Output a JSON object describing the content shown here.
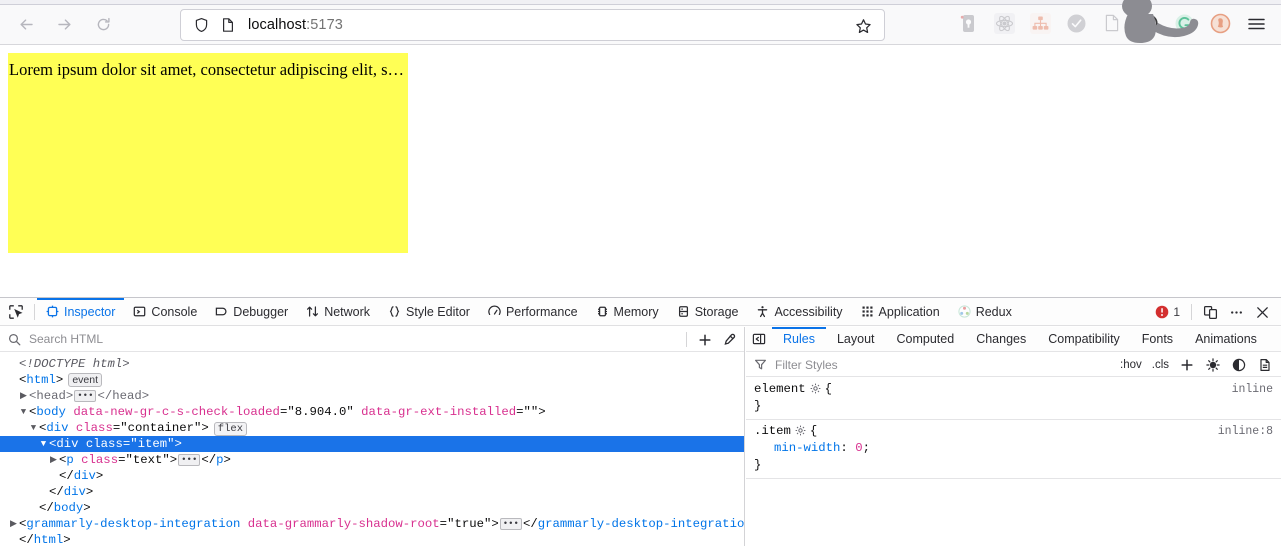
{
  "browser": {
    "nav": {
      "back_label": "Back",
      "forward_label": "Forward",
      "reload_label": "Reload"
    },
    "urlbar": {
      "host": "localhost",
      "port": ":5173",
      "shield_icon": "shield-icon",
      "page_icon": "page-icon",
      "star_icon": "bookmark-star-icon"
    },
    "extensions": [
      {
        "name": "extension-icon-password-manager"
      },
      {
        "name": "extension-icon-react-devtools"
      },
      {
        "name": "extension-icon-sitemap"
      },
      {
        "name": "extension-icon-gray-circle"
      },
      {
        "name": "extension-icon-document"
      },
      {
        "name": "extension-icon-block"
      },
      {
        "name": "extension-icon-grammarly"
      },
      {
        "name": "extension-icon-duckduckgo"
      }
    ],
    "menu_icon": "hamburger-menu-icon",
    "overlay_icon": "cat-silhouette-overlay"
  },
  "page": {
    "item_text": "Lorem ipsum dolor sit amet, consectetur adipiscing elit, sed…",
    "box_color": "#ffff55"
  },
  "devtools": {
    "picker_icon": "element-picker-icon",
    "tabs": [
      {
        "label": "Inspector",
        "icon": "inspector-icon",
        "active": true
      },
      {
        "label": "Console",
        "icon": "console-icon",
        "active": false
      },
      {
        "label": "Debugger",
        "icon": "debugger-icon",
        "active": false
      },
      {
        "label": "Network",
        "icon": "network-icon",
        "active": false
      },
      {
        "label": "Style Editor",
        "icon": "style-editor-icon",
        "active": false
      },
      {
        "label": "Performance",
        "icon": "performance-icon",
        "active": false
      },
      {
        "label": "Memory",
        "icon": "memory-icon",
        "active": false
      },
      {
        "label": "Storage",
        "icon": "storage-icon",
        "active": false
      },
      {
        "label": "Accessibility",
        "icon": "accessibility-icon",
        "active": false
      },
      {
        "label": "Application",
        "icon": "application-icon",
        "active": false
      },
      {
        "label": "Redux",
        "icon": "redux-icon",
        "active": false
      }
    ],
    "error_count": "1",
    "error_icon": "error-badge-icon",
    "responsive_icon": "responsive-design-mode-icon",
    "meatball_icon": "more-options-icon",
    "close_icon": "close-devtools-icon",
    "accent_color": "#0a73e8",
    "error_color": "#d32f2f"
  },
  "dom": {
    "search": {
      "placeholder": "Search HTML",
      "value": "",
      "icon": "search-icon"
    },
    "create_node_icon": "add-node-icon",
    "eyedropper_icon": "eyedropper-icon",
    "rows": [
      {
        "indent": 0,
        "twisty": "",
        "html": "<span class=\"tok-doctype\">&lt;!DOCTYPE html&gt;</span>",
        "selected": false,
        "name": "dom-row-doctype"
      },
      {
        "indent": 0,
        "twisty": "",
        "html": "<span class=\"tok-punct\">&lt;</span><span class=\"tok-tag\">html</span><span class=\"tok-punct\">&gt;</span><span class=\"badge-event\">event</span>",
        "selected": false,
        "name": "dom-row-html"
      },
      {
        "indent": 1,
        "twisty": "▶",
        "html": "<span class=\"tok-tag-gray\">&lt;head&gt;</span><span class=\"ellipsis-box\">•••</span><span class=\"tok-tag-gray\">&lt;/head&gt;</span>",
        "selected": false,
        "name": "dom-row-head"
      },
      {
        "indent": 1,
        "twisty": "▼",
        "html": "<span class=\"tok-punct\">&lt;</span><span class=\"tok-tag\">body</span> <span class=\"tok-attr\">data-new-gr-c-s-check-loaded</span><span class=\"tok-punct\">=</span><span class=\"tok-val\">\"8.904.0\"</span> <span class=\"tok-attr\">data-gr-ext-installed</span><span class=\"tok-punct\">=</span><span class=\"tok-val\">\"\"</span><span class=\"tok-punct\">&gt;</span>",
        "selected": false,
        "name": "dom-row-body"
      },
      {
        "indent": 2,
        "twisty": "▼",
        "html": "<span class=\"tok-punct\">&lt;</span><span class=\"tok-tag\">div</span> <span class=\"tok-attr\">class</span><span class=\"tok-punct\">=</span><span class=\"tok-val\">\"container\"</span><span class=\"tok-punct\">&gt;</span><span class=\"badge-flex\">flex</span>",
        "selected": false,
        "name": "dom-row-div-container"
      },
      {
        "indent": 3,
        "twisty": "▼",
        "html": "<span class=\"tok-punct\">&lt;</span><span class=\"tok-tag\">div</span> <span class=\"tok-attr\">class</span><span class=\"tok-punct\">=</span><span class=\"tok-val\">\"item\"</span><span class=\"tok-punct\">&gt;</span>",
        "selected": true,
        "name": "dom-row-div-item"
      },
      {
        "indent": 4,
        "twisty": "▶",
        "html": "<span class=\"tok-punct\">&lt;</span><span class=\"tok-tag\">p</span> <span class=\"tok-attr\">class</span><span class=\"tok-punct\">=</span><span class=\"tok-val\">\"text\"</span><span class=\"tok-punct\">&gt;</span><span class=\"ellipsis-box\">•••</span><span class=\"tok-punct\">&lt;/</span><span class=\"tok-tag\">p</span><span class=\"tok-punct\">&gt;</span>",
        "selected": false,
        "name": "dom-row-p-text"
      },
      {
        "indent": 4,
        "twisty": "",
        "html": "<span class=\"tok-punct\">&lt;/</span><span class=\"tok-tag\">div</span><span class=\"tok-punct\">&gt;</span>",
        "selected": false,
        "name": "dom-row-close-div-item"
      },
      {
        "indent": 3,
        "twisty": "",
        "html": "<span class=\"tok-punct\">&lt;/</span><span class=\"tok-tag\">div</span><span class=\"tok-punct\">&gt;</span>",
        "selected": false,
        "name": "dom-row-close-div-container"
      },
      {
        "indent": 2,
        "twisty": "",
        "html": "<span class=\"tok-punct\">&lt;/</span><span class=\"tok-tag\">body</span><span class=\"tok-punct\">&gt;</span>",
        "selected": false,
        "name": "dom-row-close-body"
      },
      {
        "indent": 1,
        "twisty": "▶",
        "html": "<span class=\"tok-punct\">&lt;</span><span class=\"tok-tag\">grammarly-desktop-integration</span> <span class=\"tok-attr\">data-grammarly-shadow-root</span><span class=\"tok-punct\">=</span><span class=\"tok-val\">\"true\"</span><span class=\"tok-punct\">&gt;</span><span class=\"ellipsis-box\">•••</span><span class=\"tok-punct\">&lt;/</span><span class=\"tok-tag\">grammarly-desktop-integration</span><span class=\"tok-punct\">&gt;</span>",
        "selected": false,
        "name": "dom-row-grammarly"
      },
      {
        "indent": 0,
        "twisty": "",
        "html": "<span class=\"tok-punct\">&lt;/</span><span class=\"tok-tag\">html</span><span class=\"tok-punct\">&gt;</span>",
        "selected": false,
        "name": "dom-row-close-html"
      }
    ]
  },
  "rules": {
    "sidebar_toggle_icon": "toggle-sidebar-icon",
    "tabs": [
      {
        "label": "Rules",
        "active": true
      },
      {
        "label": "Layout",
        "active": false
      },
      {
        "label": "Computed",
        "active": false
      },
      {
        "label": "Changes",
        "active": false
      },
      {
        "label": "Compatibility",
        "active": false
      },
      {
        "label": "Fonts",
        "active": false
      },
      {
        "label": "Animations",
        "active": false
      }
    ],
    "filter": {
      "placeholder": "Filter Styles",
      "value": "",
      "icon": "filter-icon"
    },
    "hov_label": ":hov",
    "cls_label": ".cls",
    "add_rule_icon": "add-rule-icon",
    "light_scheme_icon": "light-color-scheme-icon",
    "dark_scheme_icon": "dark-color-scheme-icon",
    "print_icon": "print-media-icon",
    "blocks": [
      {
        "name": "rule-block-element",
        "selector": "element",
        "origin": "inline",
        "declarations": []
      },
      {
        "name": "rule-block-item",
        "selector": ".item",
        "origin": "inline:8",
        "declarations": [
          {
            "property": "min-width",
            "value": "0"
          }
        ]
      }
    ]
  }
}
